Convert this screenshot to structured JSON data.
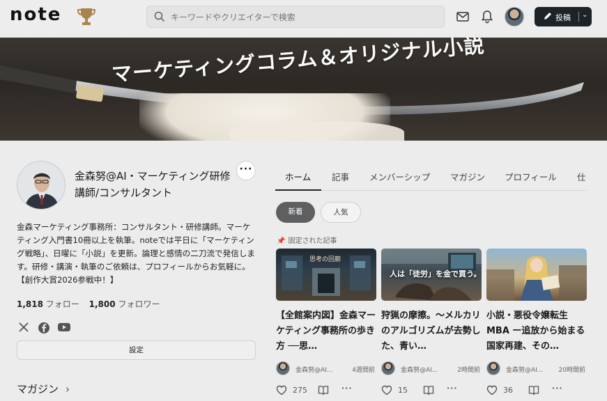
{
  "header": {
    "logo": "note",
    "search_placeholder": "キーワードやクリエイターで検索",
    "post_label": "投稿"
  },
  "banner": {
    "title": "マーケティングコラム＆オリジナル小説"
  },
  "profile": {
    "name": "金森努@AI・マーケティング研修講師/コンサルタント",
    "bio": "金森マーケティング事務所：コンサルタント・研修講師。マーケティング入門書10冊以上を執筆。noteでは平日に「マーケティング戦略」、日曜に「小説」を更新。論理と感情の二刀流で発信します。研修・講演・執筆のご依頼は、プロフィールからお気軽に。【創作大賞2026参戦中！】",
    "follow_count": "1,818",
    "follow_label": "フォロー",
    "follower_count": "1,800",
    "follower_label": "フォロワー",
    "settings_label": "設定",
    "magazine_label": "マガジン"
  },
  "tabs": [
    "ホーム",
    "記事",
    "メンバーシップ",
    "マガジン",
    "プロフィール",
    "仕"
  ],
  "filters": {
    "new_label": "新着",
    "popular_label": "人気"
  },
  "pinned_label": "固定された記事",
  "articles": [
    {
      "title": "【全館案内図】金森マーケティング事務所の歩き方 ──思…",
      "thumb_text": "思考の回廊",
      "author": "金森努@AI...",
      "time": "4週間前",
      "likes": "275"
    },
    {
      "title": "狩猟の摩擦。～メルカリのアルゴリズムが去勢した、青い…",
      "thumb_text": "人は「徒労」を金で買う。",
      "author": "金森努@AI...",
      "time": "2時間前",
      "likes": "15"
    },
    {
      "title": "小説・悪役令嬢転生MBA ー追放から始まる国家再建、その…",
      "thumb_text": "",
      "author": "金森努@AI...",
      "time": "20時間前",
      "likes": "36"
    }
  ]
}
